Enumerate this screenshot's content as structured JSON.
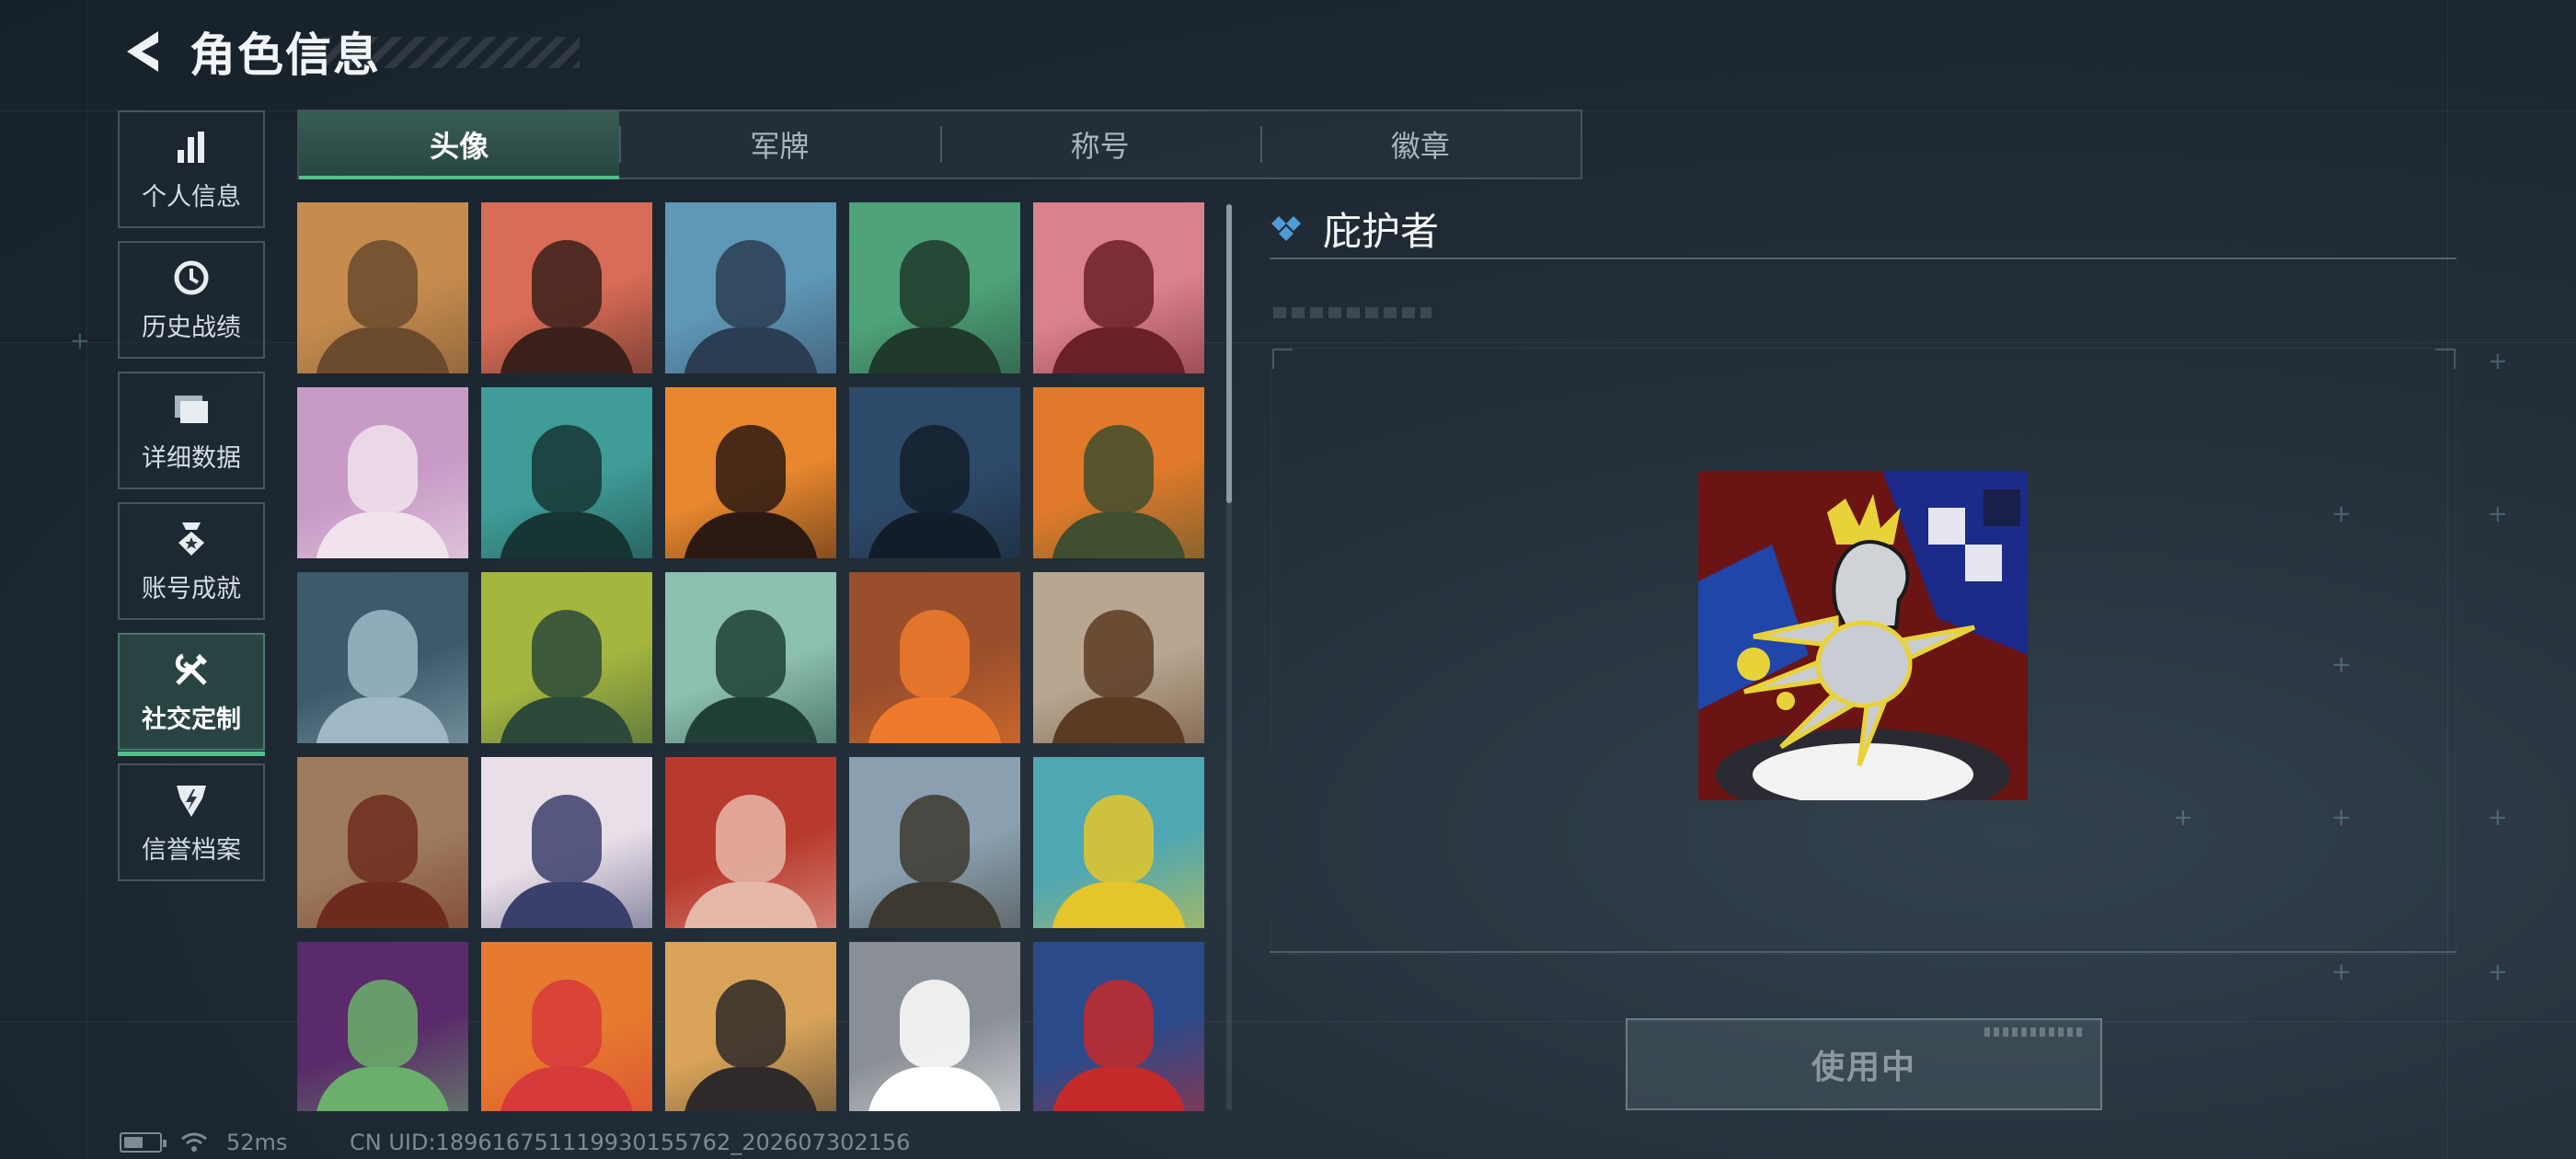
{
  "header": {
    "title": "角色信息"
  },
  "sidebar": {
    "items": [
      {
        "label": "个人信息",
        "icon": "bar-chart-icon"
      },
      {
        "label": "历史战绩",
        "icon": "history-clock-icon"
      },
      {
        "label": "详细数据",
        "icon": "folder-icon"
      },
      {
        "label": "账号成就",
        "icon": "achievement-icon"
      },
      {
        "label": "社交定制",
        "icon": "tools-icon",
        "active": true
      },
      {
        "label": "信誉档案",
        "icon": "reputation-icon"
      }
    ]
  },
  "tabs": [
    {
      "label": "头像",
      "active": true
    },
    {
      "label": "军牌"
    },
    {
      "label": "称号"
    },
    {
      "label": "徽章"
    }
  ],
  "grid": {
    "avatars": [
      {
        "name": "avatar-soldiers-sunset",
        "bg": "#c58c4e",
        "fg": "#6b4a2e"
      },
      {
        "name": "avatar-bearded-cap",
        "bg": "#d86c56",
        "fg": "#3a1f1a"
      },
      {
        "name": "avatar-pilot-goggles",
        "bg": "#5f97b6",
        "fg": "#2b3d52"
      },
      {
        "name": "avatar-headset-man",
        "bg": "#4ea37a",
        "fg": "#1f3a2a"
      },
      {
        "name": "avatar-helmet-visor",
        "bg": "#d9828c",
        "fg": "#6b2025"
      },
      {
        "name": "avatar-white-hair-girl",
        "bg": "#c79bc6",
        "fg": "#f1e3ec"
      },
      {
        "name": "avatar-teal-glasses-man",
        "bg": "#3f9c98",
        "fg": "#163634"
      },
      {
        "name": "avatar-masked-longhair",
        "bg": "#e8872e",
        "fg": "#2c1a12"
      },
      {
        "name": "avatar-night-operator",
        "bg": "#2e4a6a",
        "fg": "#121d2a"
      },
      {
        "name": "avatar-orange-soldier",
        "bg": "#e07a2a",
        "fg": "#3f4f2f"
      },
      {
        "name": "avatar-sniper-scope",
        "bg": "#3c5a6a",
        "fg": "#9eb8c6"
      },
      {
        "name": "avatar-exit-door",
        "bg": "#a5b63f",
        "fg": "#2c4a3a"
      },
      {
        "name": "avatar-way-out-sign",
        "bg": "#8cc0b0",
        "fg": "#1f3f36"
      },
      {
        "name": "avatar-orange-feather",
        "bg": "#9a4f2c",
        "fg": "#ef7a2c"
      },
      {
        "name": "avatar-desert-truck",
        "bg": "#b8a690",
        "fg": "#5c3b24"
      },
      {
        "name": "avatar-justice-scale",
        "bg": "#9e7b5c",
        "fg": "#6d2b1f"
      },
      {
        "name": "avatar-anime-chibis",
        "bg": "#e9dfe8",
        "fg": "#3b3f6b"
      },
      {
        "name": "avatar-redhead-woman",
        "bg": "#b83a2e",
        "fg": "#e6b8a8"
      },
      {
        "name": "avatar-mountain-explorer",
        "bg": "#8aa0b0",
        "fg": "#3c3a30"
      },
      {
        "name": "avatar-alligator-sign",
        "bg": "#4fa7b3",
        "fg": "#e4c52a"
      },
      {
        "name": "avatar-green-goggle-man",
        "bg": "#5a2a6a",
        "fg": "#6bb06a"
      },
      {
        "name": "avatar-monkey-reader",
        "bg": "#e67a2e",
        "fg": "#d63a3a"
      },
      {
        "name": "avatar-pyramid-glasses",
        "bg": "#d9a45a",
        "fg": "#2e2a2a"
      },
      {
        "name": "avatar-eagle-emblem",
        "bg": "#8a8f96",
        "fg": "#ffffff"
      },
      {
        "name": "avatar-santa-soldier",
        "bg": "#2b4a8a",
        "fg": "#c52a2a"
      }
    ]
  },
  "detail": {
    "title": "庇护者",
    "button_label": "使用中",
    "preview_icon": "chess-knight-hand-icon"
  },
  "status": {
    "ping": "52ms",
    "uid": "CN UID:18961675111993015576​2_202607302156"
  },
  "colors": {
    "accent": "#4fc08a",
    "diamond": "#4f9bd8"
  }
}
